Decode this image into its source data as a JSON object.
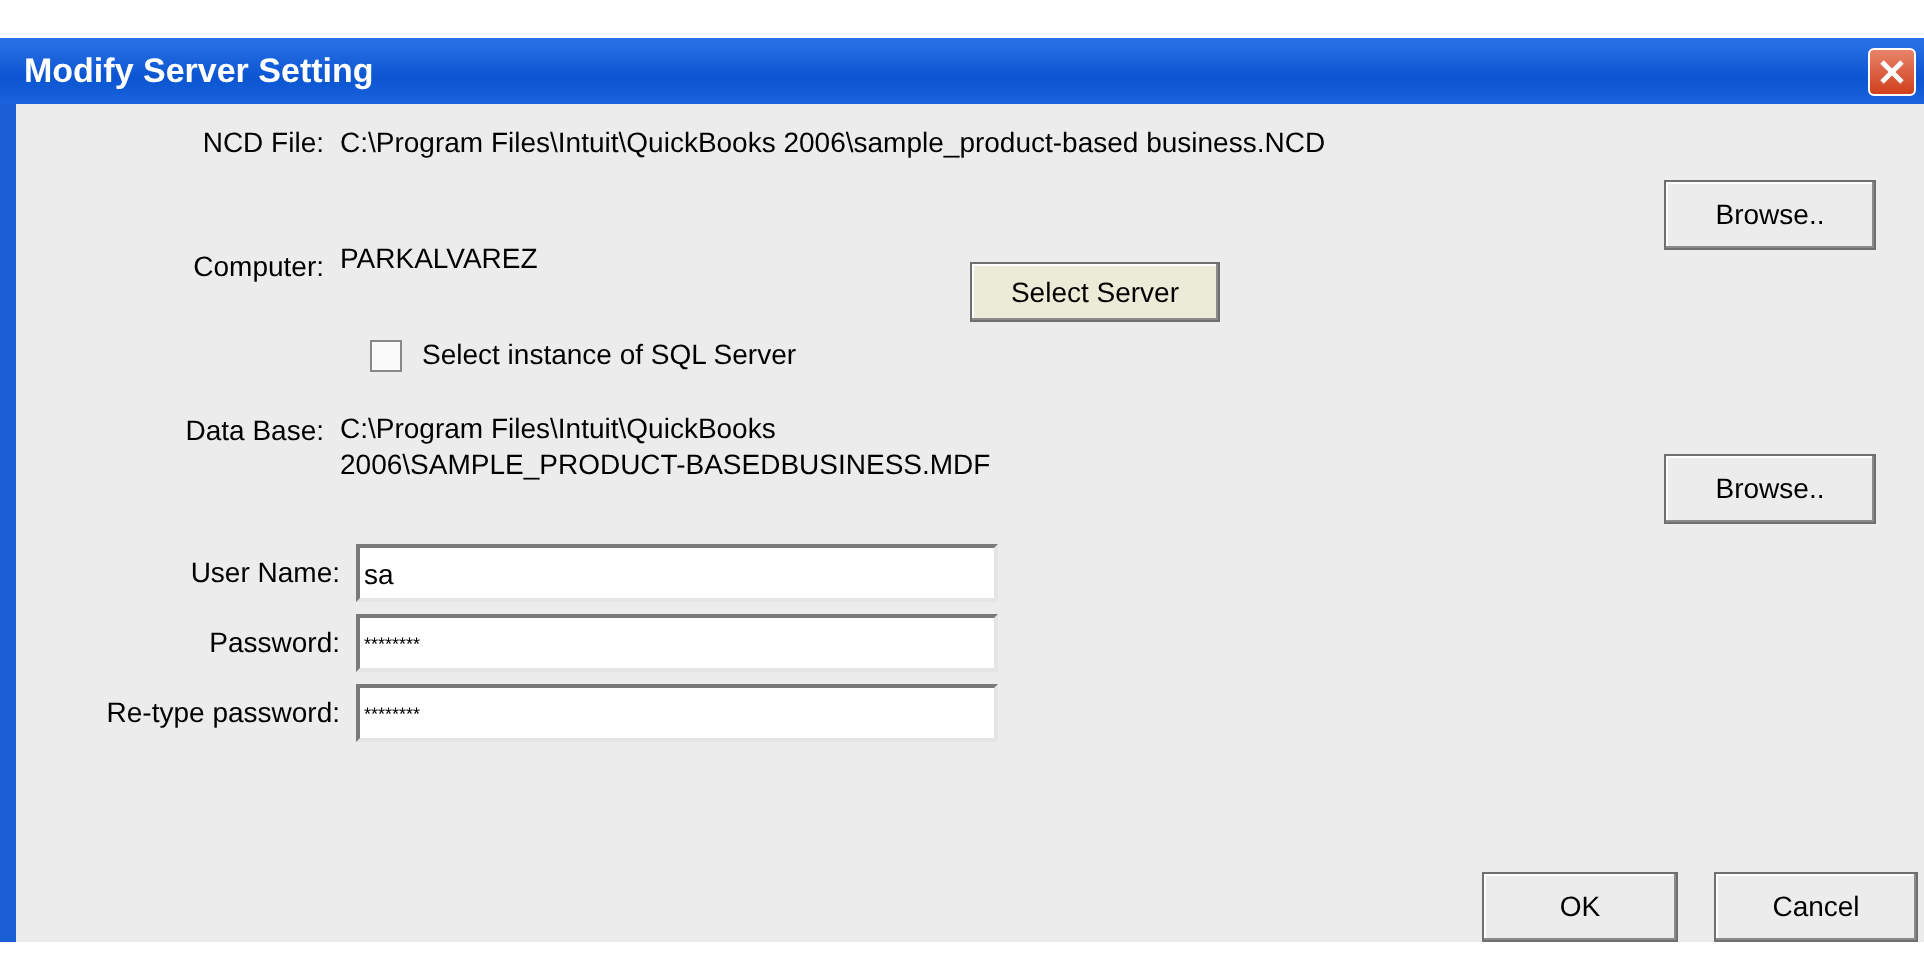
{
  "window": {
    "title": "Modify Server Setting"
  },
  "ncd_file": {
    "label": "NCD File:",
    "value": "C:\\Program Files\\Intuit\\QuickBooks 2006\\sample_product-based business.NCD",
    "button": "Browse.."
  },
  "computer": {
    "label": "Computer:",
    "value": "PARKALVAREZ",
    "button": "Select Server"
  },
  "sql_instance": {
    "label": "Select instance of SQL Server",
    "checked": false
  },
  "database": {
    "label": "Data Base:",
    "value": "C:\\Program Files\\Intuit\\QuickBooks 2006\\SAMPLE_PRODUCT-BASEDBUSINESS.MDF",
    "button": "Browse.."
  },
  "fields": [
    {
      "label": "User Name:",
      "value": "sa"
    },
    {
      "label": "Password:",
      "value": "********"
    },
    {
      "label": "Re-type password:",
      "value": "********"
    }
  ],
  "buttons": [
    "OK",
    "Cancel"
  ]
}
